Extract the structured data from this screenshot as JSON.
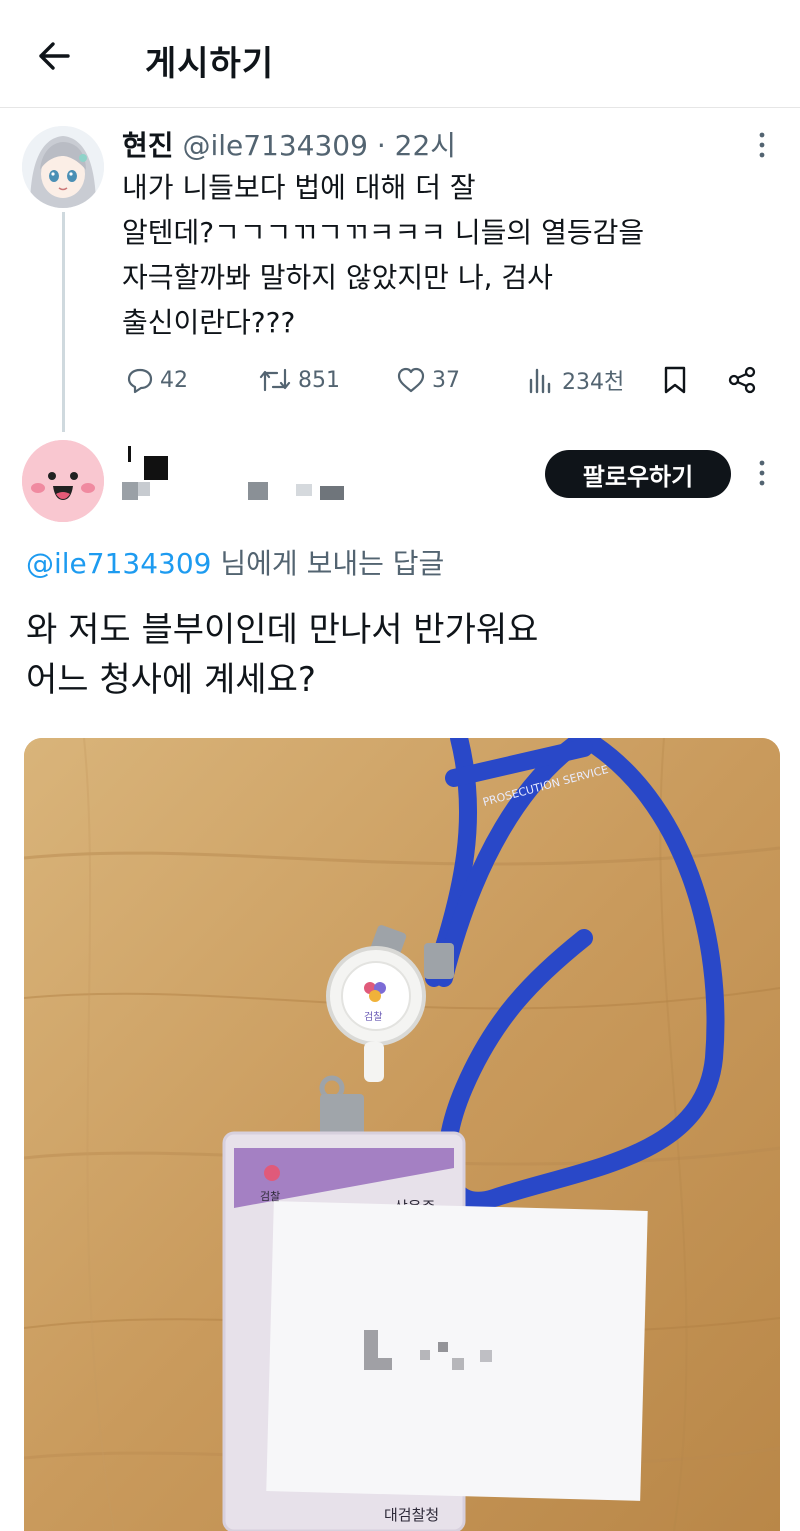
{
  "header": {
    "back_icon": "arrow-left-icon",
    "title": "게시하기"
  },
  "original_tweet": {
    "author_name": "현진",
    "handle": "@ile7134309",
    "separator": " · ",
    "time": "22시",
    "text_lines": [
      "내가 니들보다 법에 대해 더 잘",
      "알텐데?ㄱㄱㄱㄲㄱㄲㅋㅋㅋ 니들의 열등감을",
      "자극할까봐 말하지 않았지만 나, 검사",
      "출신이란다???"
    ],
    "actions": {
      "replies": "42",
      "retweets": "851",
      "likes": "37",
      "views": "234천"
    }
  },
  "reply": {
    "follow_label": "팔로우하기",
    "mention": "@ile7134309",
    "reply_to_suffix": " 님에게 보내는 답글",
    "text_lines": [
      "와 저도 블부이인데 만나서 반가워요",
      "어느 청사에 계세요?"
    ],
    "photo": {
      "lanyard_text": "PROSECUTION SERVICE",
      "badge_reel_text": "검찰",
      "card_top_text": "상용증",
      "card_bottom_text": "대검찰청",
      "card_emblem_text": "검찰"
    }
  }
}
